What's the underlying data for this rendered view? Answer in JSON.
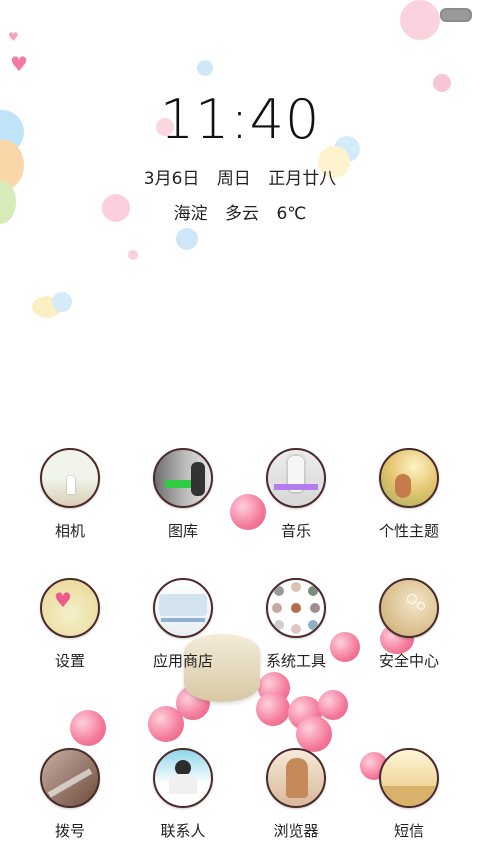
{
  "status": {
    "battery_icon": "battery-icon"
  },
  "clock": {
    "time": "11:40"
  },
  "date": {
    "date": "3月6日",
    "weekday": "周日",
    "lunar": "正月廿八"
  },
  "weather": {
    "city": "海淀",
    "condition": "多云",
    "temp": "6℃"
  },
  "apps": [
    {
      "label": "相机",
      "icon": "camera-icon"
    },
    {
      "label": "图库",
      "icon": "gallery-icon"
    },
    {
      "label": "音乐",
      "icon": "music-icon"
    },
    {
      "label": "个性主题",
      "icon": "theme-icon"
    },
    {
      "label": "设置",
      "icon": "settings-icon"
    },
    {
      "label": "应用商店",
      "icon": "app-store-icon"
    },
    {
      "label": "系统工具",
      "icon": "system-tools-icon"
    },
    {
      "label": "安全中心",
      "icon": "security-center-icon"
    },
    {
      "label": "拨号",
      "icon": "phone-icon"
    },
    {
      "label": "联系人",
      "icon": "contacts-icon"
    },
    {
      "label": "浏览器",
      "icon": "browser-icon"
    },
    {
      "label": "短信",
      "icon": "sms-icon"
    }
  ]
}
